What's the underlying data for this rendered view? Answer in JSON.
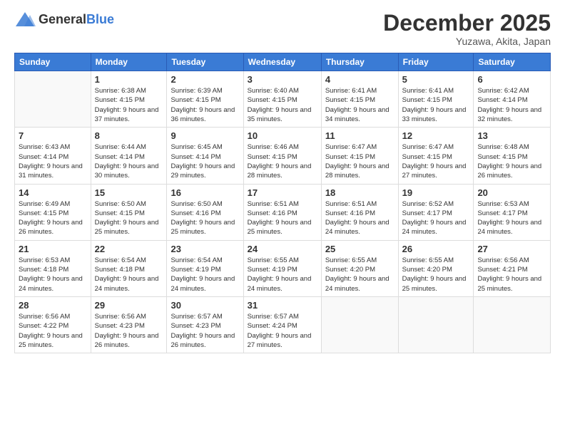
{
  "logo": {
    "general": "General",
    "blue": "Blue"
  },
  "header": {
    "month": "December 2025",
    "location": "Yuzawa, Akita, Japan"
  },
  "weekdays": [
    "Sunday",
    "Monday",
    "Tuesday",
    "Wednesday",
    "Thursday",
    "Friday",
    "Saturday"
  ],
  "weeks": [
    [
      {
        "day": "",
        "sunrise": "",
        "sunset": "",
        "daylight": ""
      },
      {
        "day": "1",
        "sunrise": "Sunrise: 6:38 AM",
        "sunset": "Sunset: 4:15 PM",
        "daylight": "Daylight: 9 hours and 37 minutes."
      },
      {
        "day": "2",
        "sunrise": "Sunrise: 6:39 AM",
        "sunset": "Sunset: 4:15 PM",
        "daylight": "Daylight: 9 hours and 36 minutes."
      },
      {
        "day": "3",
        "sunrise": "Sunrise: 6:40 AM",
        "sunset": "Sunset: 4:15 PM",
        "daylight": "Daylight: 9 hours and 35 minutes."
      },
      {
        "day": "4",
        "sunrise": "Sunrise: 6:41 AM",
        "sunset": "Sunset: 4:15 PM",
        "daylight": "Daylight: 9 hours and 34 minutes."
      },
      {
        "day": "5",
        "sunrise": "Sunrise: 6:41 AM",
        "sunset": "Sunset: 4:15 PM",
        "daylight": "Daylight: 9 hours and 33 minutes."
      },
      {
        "day": "6",
        "sunrise": "Sunrise: 6:42 AM",
        "sunset": "Sunset: 4:14 PM",
        "daylight": "Daylight: 9 hours and 32 minutes."
      }
    ],
    [
      {
        "day": "7",
        "sunrise": "Sunrise: 6:43 AM",
        "sunset": "Sunset: 4:14 PM",
        "daylight": "Daylight: 9 hours and 31 minutes."
      },
      {
        "day": "8",
        "sunrise": "Sunrise: 6:44 AM",
        "sunset": "Sunset: 4:14 PM",
        "daylight": "Daylight: 9 hours and 30 minutes."
      },
      {
        "day": "9",
        "sunrise": "Sunrise: 6:45 AM",
        "sunset": "Sunset: 4:14 PM",
        "daylight": "Daylight: 9 hours and 29 minutes."
      },
      {
        "day": "10",
        "sunrise": "Sunrise: 6:46 AM",
        "sunset": "Sunset: 4:15 PM",
        "daylight": "Daylight: 9 hours and 28 minutes."
      },
      {
        "day": "11",
        "sunrise": "Sunrise: 6:47 AM",
        "sunset": "Sunset: 4:15 PM",
        "daylight": "Daylight: 9 hours and 28 minutes."
      },
      {
        "day": "12",
        "sunrise": "Sunrise: 6:47 AM",
        "sunset": "Sunset: 4:15 PM",
        "daylight": "Daylight: 9 hours and 27 minutes."
      },
      {
        "day": "13",
        "sunrise": "Sunrise: 6:48 AM",
        "sunset": "Sunset: 4:15 PM",
        "daylight": "Daylight: 9 hours and 26 minutes."
      }
    ],
    [
      {
        "day": "14",
        "sunrise": "Sunrise: 6:49 AM",
        "sunset": "Sunset: 4:15 PM",
        "daylight": "Daylight: 9 hours and 26 minutes."
      },
      {
        "day": "15",
        "sunrise": "Sunrise: 6:50 AM",
        "sunset": "Sunset: 4:15 PM",
        "daylight": "Daylight: 9 hours and 25 minutes."
      },
      {
        "day": "16",
        "sunrise": "Sunrise: 6:50 AM",
        "sunset": "Sunset: 4:16 PM",
        "daylight": "Daylight: 9 hours and 25 minutes."
      },
      {
        "day": "17",
        "sunrise": "Sunrise: 6:51 AM",
        "sunset": "Sunset: 4:16 PM",
        "daylight": "Daylight: 9 hours and 25 minutes."
      },
      {
        "day": "18",
        "sunrise": "Sunrise: 6:51 AM",
        "sunset": "Sunset: 4:16 PM",
        "daylight": "Daylight: 9 hours and 24 minutes."
      },
      {
        "day": "19",
        "sunrise": "Sunrise: 6:52 AM",
        "sunset": "Sunset: 4:17 PM",
        "daylight": "Daylight: 9 hours and 24 minutes."
      },
      {
        "day": "20",
        "sunrise": "Sunrise: 6:53 AM",
        "sunset": "Sunset: 4:17 PM",
        "daylight": "Daylight: 9 hours and 24 minutes."
      }
    ],
    [
      {
        "day": "21",
        "sunrise": "Sunrise: 6:53 AM",
        "sunset": "Sunset: 4:18 PM",
        "daylight": "Daylight: 9 hours and 24 minutes."
      },
      {
        "day": "22",
        "sunrise": "Sunrise: 6:54 AM",
        "sunset": "Sunset: 4:18 PM",
        "daylight": "Daylight: 9 hours and 24 minutes."
      },
      {
        "day": "23",
        "sunrise": "Sunrise: 6:54 AM",
        "sunset": "Sunset: 4:19 PM",
        "daylight": "Daylight: 9 hours and 24 minutes."
      },
      {
        "day": "24",
        "sunrise": "Sunrise: 6:55 AM",
        "sunset": "Sunset: 4:19 PM",
        "daylight": "Daylight: 9 hours and 24 minutes."
      },
      {
        "day": "25",
        "sunrise": "Sunrise: 6:55 AM",
        "sunset": "Sunset: 4:20 PM",
        "daylight": "Daylight: 9 hours and 24 minutes."
      },
      {
        "day": "26",
        "sunrise": "Sunrise: 6:55 AM",
        "sunset": "Sunset: 4:20 PM",
        "daylight": "Daylight: 9 hours and 25 minutes."
      },
      {
        "day": "27",
        "sunrise": "Sunrise: 6:56 AM",
        "sunset": "Sunset: 4:21 PM",
        "daylight": "Daylight: 9 hours and 25 minutes."
      }
    ],
    [
      {
        "day": "28",
        "sunrise": "Sunrise: 6:56 AM",
        "sunset": "Sunset: 4:22 PM",
        "daylight": "Daylight: 9 hours and 25 minutes."
      },
      {
        "day": "29",
        "sunrise": "Sunrise: 6:56 AM",
        "sunset": "Sunset: 4:23 PM",
        "daylight": "Daylight: 9 hours and 26 minutes."
      },
      {
        "day": "30",
        "sunrise": "Sunrise: 6:57 AM",
        "sunset": "Sunset: 4:23 PM",
        "daylight": "Daylight: 9 hours and 26 minutes."
      },
      {
        "day": "31",
        "sunrise": "Sunrise: 6:57 AM",
        "sunset": "Sunset: 4:24 PM",
        "daylight": "Daylight: 9 hours and 27 minutes."
      },
      {
        "day": "",
        "sunrise": "",
        "sunset": "",
        "daylight": ""
      },
      {
        "day": "",
        "sunrise": "",
        "sunset": "",
        "daylight": ""
      },
      {
        "day": "",
        "sunrise": "",
        "sunset": "",
        "daylight": ""
      }
    ]
  ]
}
